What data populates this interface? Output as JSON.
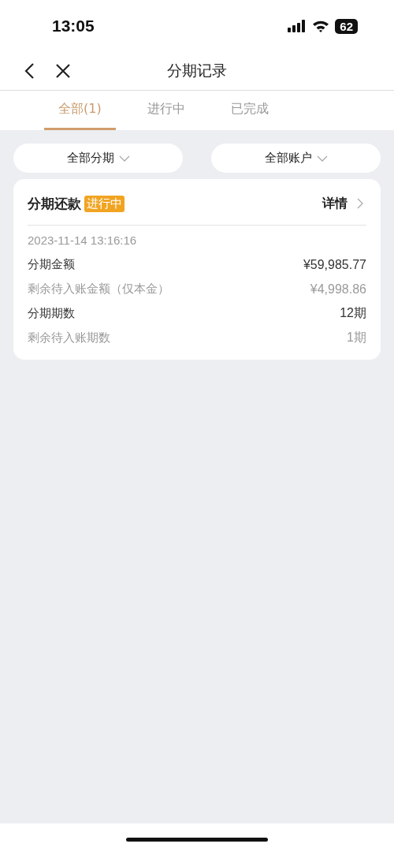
{
  "status_bar": {
    "time": "13:05",
    "battery_text": "62"
  },
  "nav": {
    "title": "分期记录"
  },
  "tabs": [
    {
      "label": "全部(1)",
      "selected": true
    },
    {
      "label": "进行中",
      "selected": false
    },
    {
      "label": "已完成",
      "selected": false
    }
  ],
  "filters": [
    {
      "label": "全部分期"
    },
    {
      "label": "全部账户"
    }
  ],
  "records": [
    {
      "title": "分期还款",
      "status": "进行中",
      "detail_link": "详情",
      "date": "2023-11-14 13:16:16",
      "rows": [
        {
          "label": "分期金额",
          "value": "¥59,985.77",
          "muted": false
        },
        {
          "label": "剩余待入账金额（仅本金）",
          "value": "¥4,998.86",
          "muted": true
        },
        {
          "label": "分期期数",
          "value": "12期",
          "muted": false
        },
        {
          "label": "剩余待入账期数",
          "value": "1期",
          "muted": true
        }
      ]
    }
  ]
}
